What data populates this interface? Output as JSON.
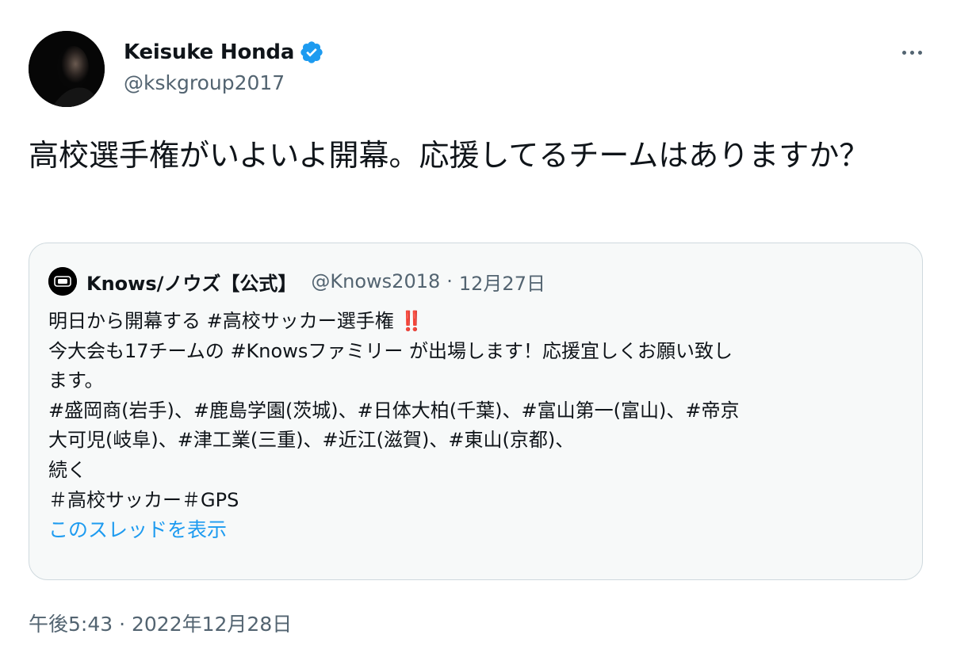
{
  "tweet": {
    "author_name": "Keisuke Honda",
    "author_handle": "@kskgroup2017",
    "verified_icon": "verified-badge-icon",
    "more_icon": "more-options-icon",
    "text": "高校選手権がいよいよ開幕。応援してるチームはありますか？",
    "timestamp": "午後5:43 · 2022年12月28日"
  },
  "quote": {
    "author_name": "Knows/ノウズ【公式】",
    "author_handle": "@Knows2018",
    "separator": "·",
    "date": "12月27日",
    "line1_text": "明日から開幕する #高校サッカー選手権 ",
    "line1_emoji": "‼️",
    "lines": [
      "今大会も17チームの #Knowsファミリー が出場します！応援宜しくお願い致し",
      "ます。",
      "#盛岡商(岩手)、#鹿島学園(茨城)、#日体大柏(千葉)、#富山第一(富山)、#帝京",
      "大可児(岐阜)、#津工業(三重)、#近江(滋賀)、#東山(京都)、",
      "続く",
      "＃高校サッカー＃GPS"
    ],
    "show_thread": "このスレッドを表示"
  },
  "colors": {
    "text": "#0f1419",
    "secondary": "#536471",
    "link": "#1d9bf0",
    "verified": "#1d9bf0",
    "quote_bg": "#f7f9f9",
    "border": "#cfd9de"
  }
}
